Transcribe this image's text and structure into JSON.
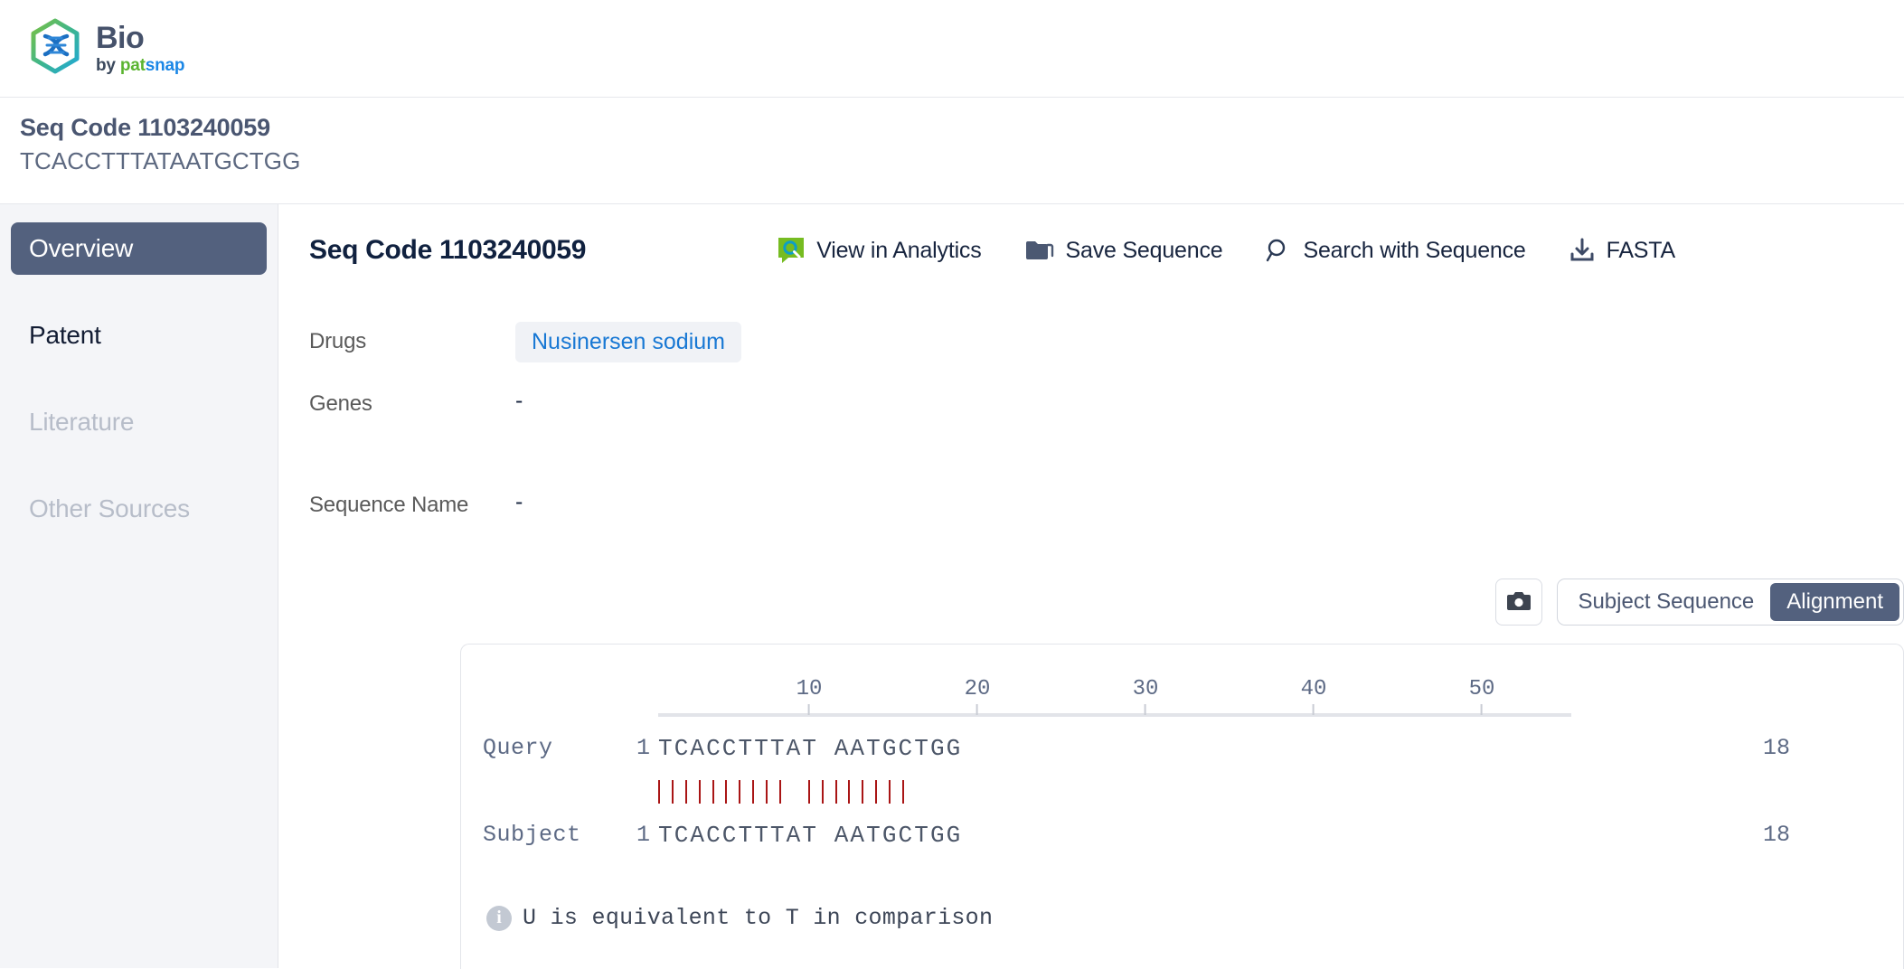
{
  "brand": {
    "title": "Bio",
    "by": "by ",
    "pat": "pat",
    "snap": "snap",
    "logo_icon": "dna-hexagon-logo",
    "colors": {
      "pat_green": "#5bb431",
      "snap_blue": "#1b87e6",
      "title_slate": "#46526b"
    }
  },
  "seq_header": {
    "title": "Seq Code 1103240059",
    "sequence": "TCACCTTTATAATGCTGG"
  },
  "sidebar": {
    "items": [
      {
        "label": "Overview",
        "state": "active"
      },
      {
        "label": "Patent",
        "state": "enabled"
      },
      {
        "label": "Literature",
        "state": "disabled"
      },
      {
        "label": "Other Sources",
        "state": "disabled"
      }
    ]
  },
  "main": {
    "title": "Seq Code 1103240059",
    "actions": [
      {
        "label": "View in Analytics",
        "icon": "analytics-icon"
      },
      {
        "label": "Save Sequence",
        "icon": "folder-icon"
      },
      {
        "label": "Search with Sequence",
        "icon": "search-icon"
      },
      {
        "label": "FASTA",
        "icon": "download-icon"
      }
    ],
    "info_rows": [
      {
        "label": "Drugs",
        "value": "Nusinersen sodium",
        "type": "chip"
      },
      {
        "label": "Genes",
        "value": "-",
        "type": "text"
      },
      {
        "label": "Sequence Name",
        "value": "-",
        "type": "text"
      }
    ]
  },
  "view_controls": {
    "camera_icon": "camera-icon",
    "segments": [
      {
        "label": "Subject Sequence",
        "active": false
      },
      {
        "label": "Alignment",
        "active": true
      }
    ]
  },
  "alignment": {
    "ruler_ticks": [
      "10",
      "20",
      "30",
      "40",
      "50"
    ],
    "rows": [
      {
        "label": "Query",
        "start": "1",
        "sequence": "TCACCTTTAT AATGCTGG",
        "end": "18"
      },
      {
        "label": "Subject",
        "start": "1",
        "sequence": "TCACCTTTAT AATGCTGG",
        "end": "18"
      }
    ],
    "match_pattern": "|||||||||| ||||||||",
    "match_color": "#a91515",
    "note": "U is equivalent to T in comparison",
    "note_icon": "info-icon"
  }
}
